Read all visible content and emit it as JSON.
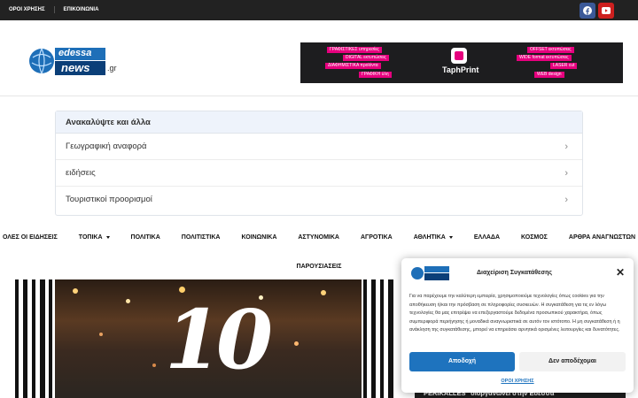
{
  "topbar": {
    "links": [
      "ΟΡΟΙ ΧΡΗΣΗΣ",
      "ΕΠΙΚΟΙΝΩΝΙΑ"
    ],
    "social": [
      "facebook-icon",
      "youtube-icon"
    ],
    "colors": {
      "bar": "#222222",
      "facebook": "#3b5998",
      "youtube": "#cd201f"
    }
  },
  "logo": {
    "text_main": "edessa",
    "text_sub": "news",
    "suffix": ".gr"
  },
  "banner": {
    "brand": "TaphPrint",
    "left_tags": [
      "ΓΡΑΦΙΣΤΙΚΕΣ υπηρεσίες",
      "DIGITAL εκτυπώσεις",
      "ΔΙΑΦΗΜΙΣΤΙΚΑ προϊόντα",
      "ΓΡΑΦΙΚΗ ύλη"
    ],
    "right_tags": [
      "OFFSET εκτυπώσεις",
      "WIDE format εκτυπώσεις",
      "LASER cut",
      "WEB design"
    ],
    "accent": "#e6007e"
  },
  "related": {
    "heading": "Ανακαλύψτε και άλλα",
    "items": [
      "Γεωγραφική αναφορά",
      "ειδήσεις",
      "Τουριστικοί προορισμοί"
    ]
  },
  "nav": {
    "items": [
      {
        "label": "ΟΛΕΣ ΟΙ ΕΙΔΗΣΕΙΣ",
        "dropdown": false
      },
      {
        "label": "ΤΟΠΙΚΑ",
        "dropdown": true
      },
      {
        "label": "ΠΟΛΙΤΙΚΑ",
        "dropdown": false
      },
      {
        "label": "ΠΟΛΙΤΙΣΤΙΚΑ",
        "dropdown": false
      },
      {
        "label": "ΚΟΙΝΩΝΙΚΑ",
        "dropdown": false
      },
      {
        "label": "ΑΣΤΥΝΟΜΙΚΑ",
        "dropdown": false
      },
      {
        "label": "ΑΓΡΟΤΙΚΑ",
        "dropdown": false
      },
      {
        "label": "ΑΘΛΗΤΙΚΑ",
        "dropdown": true
      },
      {
        "label": "ΕΛΛΑΔΑ",
        "dropdown": false
      },
      {
        "label": "ΚΟΣΜΟΣ",
        "dropdown": false
      },
      {
        "label": "ΑΡΘΡΑ ΑΝΑΓΝΩΣΤΩΝ",
        "dropdown": false
      }
    ],
    "second_row": "ΠΑΡΟΥΣΙΑΣΕΙΣ"
  },
  "hero": {
    "overlay_number": "10"
  },
  "caption": {
    "text": "PERIKALLES\" διοργανώνει στην Εδεσσα"
  },
  "consent": {
    "title": "Διαχείριση Συγκατάθεσης",
    "body": "Για να παρέχουμε την καλύτερη εμπειρία, χρησιμοποιούμε τεχνολογίες όπως cookies για την αποθήκευση ή/και την πρόσβαση σε πληροφορίες συσκευών. Η συγκατάθεση για τις εν λόγω τεχνολογίες θα μας επιτρέψει να επεξεργαστούμε δεδομένα προσωπικού χαρακτήρα, όπως συμπεριφορά περιήγησης ή μοναδικά αναγνωριστικά σε αυτόν τον ιστότοπο. Η μη συγκατάθεση ή η ανάκληση της συγκατάθεσης, μπορεί να επηρεάσει αρνητικά ορισμένες λειτουργίες και δυνατότητες.",
    "accept": "Αποδοχή",
    "deny": "Δεν αποδέχομαι",
    "terms": "ΟΡΟΙ ΧΡΗΣΗΣ",
    "accent": "#1e73be"
  }
}
